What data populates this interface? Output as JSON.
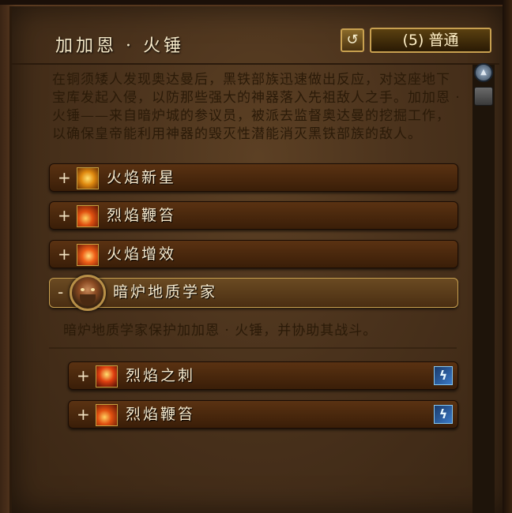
{
  "header": {
    "title": "加加恩 · 火锤",
    "reset_icon": "↺",
    "difficulty": "(5) 普通"
  },
  "description": "在铜须矮人发现奥达曼后，黑铁部族迅速做出反应，对这座地下宝库发起入侵，以防那些强大的神器落入先祖敌人之手。加加恩 · 火锤——来自暗炉城的参议员，被派去监督奥达曼的挖掘工作，以确保皇帝能利用神器的毁灭性潜能消灭黑铁部族的敌人。",
  "abilities": [
    {
      "toggle": "+",
      "label": "火焰新星",
      "icon": "fire-nova-icon"
    },
    {
      "toggle": "+",
      "label": "烈焰鞭笞",
      "icon": "flame-lash-icon"
    },
    {
      "toggle": "+",
      "label": "火焰增效",
      "icon": "fire-empower-icon"
    }
  ],
  "expanded": {
    "toggle": "-",
    "label": "暗炉地质学家",
    "description": "暗炉地质学家保护加加恩 · 火锤，并协助其战斗。",
    "children": [
      {
        "toggle": "+",
        "label": "烈焰之刺",
        "icon": "flame-spike-icon",
        "tag_icon": "interrupt-lightning-icon",
        "tag_glyph": "ϟ"
      },
      {
        "toggle": "+",
        "label": "烈焰鞭笞",
        "icon": "flame-lash-icon",
        "tag_icon": "interrupt-lightning-icon",
        "tag_glyph": "ϟ"
      }
    ]
  },
  "scroll": {
    "up_glyph": "▲"
  },
  "colors": {
    "parchment": "#4a321c",
    "row": "#4a2810",
    "gold_border": "#c8a050",
    "text_light": "#f8ecd0",
    "text_dark": "#2a1a08"
  }
}
